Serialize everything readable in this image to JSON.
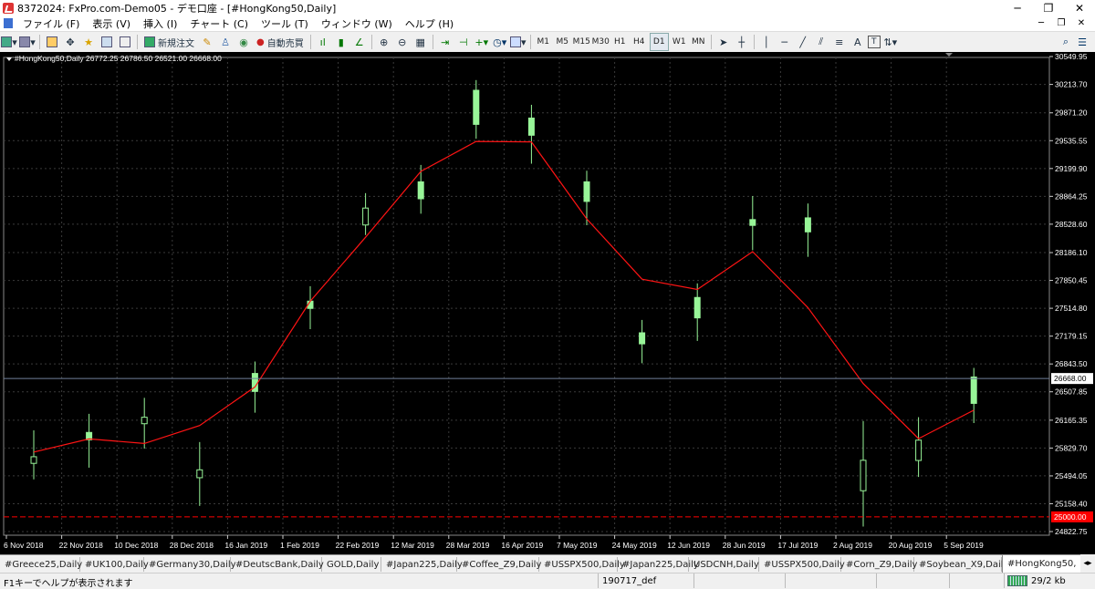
{
  "window": {
    "title": "8372024: FxPro.com-Demo05 - デモ口座 - [#HongKong50,Daily]",
    "controls": [
      "─",
      "❐",
      "✕"
    ]
  },
  "menu": {
    "items": [
      "ファイル (F)",
      "表示 (V)",
      "挿入 (I)",
      "チャート (C)",
      "ツール (T)",
      "ウィンドウ (W)",
      "ヘルプ (H)"
    ],
    "mdi_controls": [
      "─",
      "❐",
      "✕"
    ]
  },
  "toolbar": {
    "new_order_label": "新規注文",
    "autotrade_label": "自動売買",
    "timeframes": [
      "M1",
      "M5",
      "M15",
      "M30",
      "H1",
      "H4",
      "D1",
      "W1",
      "MN"
    ],
    "active_timeframe": "D1",
    "text_tool": "A",
    "label_tool": "T"
  },
  "chart": {
    "info": "#HongKong50,Daily  26772.25 26786.50 26521.00 26668.00",
    "current_price": "26668.00",
    "alert_price": "25000.00",
    "price_labels": [
      "30549.95",
      "30213.70",
      "29871.20",
      "29535.55",
      "29199.90",
      "28864.25",
      "28528.60",
      "28186.10",
      "27850.45",
      "27514.80",
      "27179.15",
      "26843.50",
      "26507.85",
      "26165.35",
      "25829.70",
      "25494.05",
      "25158.40",
      "24822.75"
    ],
    "date_labels": [
      "6 Nov 2018",
      "22 Nov 2018",
      "10 Dec 2018",
      "28 Dec 2018",
      "16 Jan 2019",
      "1 Feb 2019",
      "22 Feb 2019",
      "12 Mar 2019",
      "28 Mar 2019",
      "16 Apr 2019",
      "7 May 2019",
      "24 May 2019",
      "12 Jun 2019",
      "28 Jun 2019",
      "17 Jul 2019",
      "2 Aug 2019",
      "20 Aug 2019",
      "5 Sep 2019"
    ],
    "colors": {
      "background": "#000000",
      "bull": "#98f598",
      "ma": "#ff1414",
      "grid": "#3a3a3a",
      "alert": "#ff0000"
    },
    "series": [
      {
        "t": "6 Nov 2018",
        "o": 25725,
        "h": 26043,
        "l": 25452,
        "c": 25645
      },
      {
        "t": "22 Nov 2018",
        "o": 25928,
        "h": 26242,
        "l": 25593,
        "c": 26018
      },
      {
        "t": "10 Dec 2018",
        "o": 26201,
        "h": 26435,
        "l": 25823,
        "c": 26123
      },
      {
        "t": "28 Dec 2018",
        "o": 25567,
        "h": 25902,
        "l": 25132,
        "c": 25472
      },
      {
        "t": "16 Jan 2019",
        "o": 26512,
        "h": 26873,
        "l": 26256,
        "c": 26729
      },
      {
        "t": "1 Feb 2019",
        "o": 27513,
        "h": 27781,
        "l": 27263,
        "c": 27601
      },
      {
        "t": "22 Feb 2019",
        "o": 28723,
        "h": 28903,
        "l": 28398,
        "c": 28519
      },
      {
        "t": "12 Mar 2019",
        "o": 28835,
        "h": 29243,
        "l": 28655,
        "c": 29039
      },
      {
        "t": "28 Mar 2019",
        "o": 29732,
        "h": 30266,
        "l": 29559,
        "c": 30143
      },
      {
        "t": "16 Apr 2019",
        "o": 29601,
        "h": 29968,
        "l": 29258,
        "c": 29808
      },
      {
        "t": "7 May 2019",
        "o": 28803,
        "h": 29173,
        "l": 28516,
        "c": 29039
      },
      {
        "t": "24 May 2019",
        "o": 27086,
        "h": 27374,
        "l": 26852,
        "c": 27219
      },
      {
        "t": "12 Jun 2019",
        "o": 27399,
        "h": 27815,
        "l": 27121,
        "c": 27645
      },
      {
        "t": "28 Jun 2019",
        "o": 28514,
        "h": 28868,
        "l": 28215,
        "c": 28584
      },
      {
        "t": "17 Jul 2019",
        "o": 28436,
        "h": 28778,
        "l": 28135,
        "c": 28605
      },
      {
        "t": "2 Aug 2019",
        "o": 25682,
        "h": 26155,
        "l": 24883,
        "c": 25315
      },
      {
        "t": "20 Aug 2019",
        "o": 25925,
        "h": 26202,
        "l": 25481,
        "c": 25680
      },
      {
        "t": "5 Sep 2019",
        "o": 26368,
        "h": 26796,
        "l": 26131,
        "c": 26686
      }
    ]
  },
  "tabs": [
    "#Greece25,Daily",
    "#UK100,Daily",
    "#Germany30,Daily",
    "#DeutscBank,Daily",
    "GOLD,Daily",
    "#Japan225,Daily",
    "#Coffee_Z9,Daily",
    "#USSPX500,Daily",
    "#Japan225,Daily",
    "USDCNH,Daily",
    "#USSPX500,Daily",
    "#Corn_Z9,Daily",
    "#Soybean_X9,Daily",
    "#HongKong50,"
  ],
  "active_tab": "#HongKong50,",
  "status": {
    "help": "F1キーでヘルプが表示されます",
    "profile": "190717_def",
    "traffic": "29/2 kb"
  }
}
